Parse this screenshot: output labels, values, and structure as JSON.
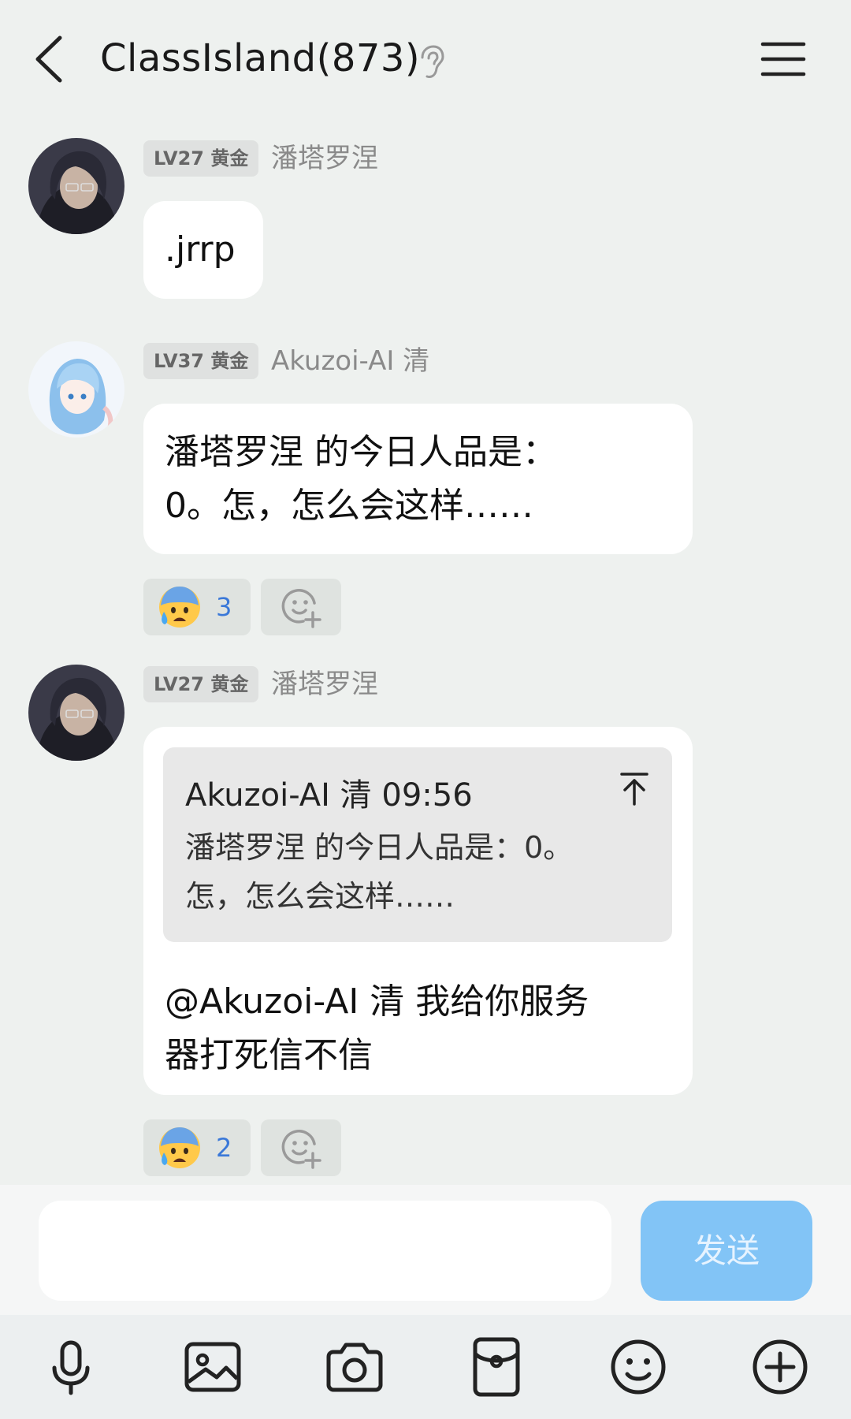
{
  "header": {
    "title": "ClassIsland(873)"
  },
  "messages": [
    {
      "badge": "LV27 黄金",
      "sender": "潘塔罗涅",
      "text": ".jrrp"
    },
    {
      "badge": "LV37 黄金",
      "sender": "Akuzoi-AI 清",
      "text_line1": "潘塔罗涅 的今日人品是：",
      "text_line2": "0。怎，怎么会这样……",
      "reaction_count": "3"
    },
    {
      "badge": "LV27 黄金",
      "sender": "潘塔罗涅",
      "quote_header": "Akuzoi-AI 清 09:56",
      "quote_line1": "潘塔罗涅 的今日人品是：0。",
      "quote_line2": "怎，怎么会这样……",
      "text_line1": " @Akuzoi-AI 清 我给你服务",
      "text_line2": "器打死信不信",
      "reaction_count": "2"
    }
  ],
  "composer": {
    "input_value": "",
    "send_label": "发送"
  },
  "toolbar": {
    "icons": [
      "microphone-icon",
      "image-icon",
      "camera-icon",
      "red-packet-icon",
      "emoji-icon",
      "plus-icon"
    ]
  },
  "colors": {
    "background": "#eef1ef",
    "send_button": "#82c4f6",
    "reaction_count": "#3a78d8"
  }
}
